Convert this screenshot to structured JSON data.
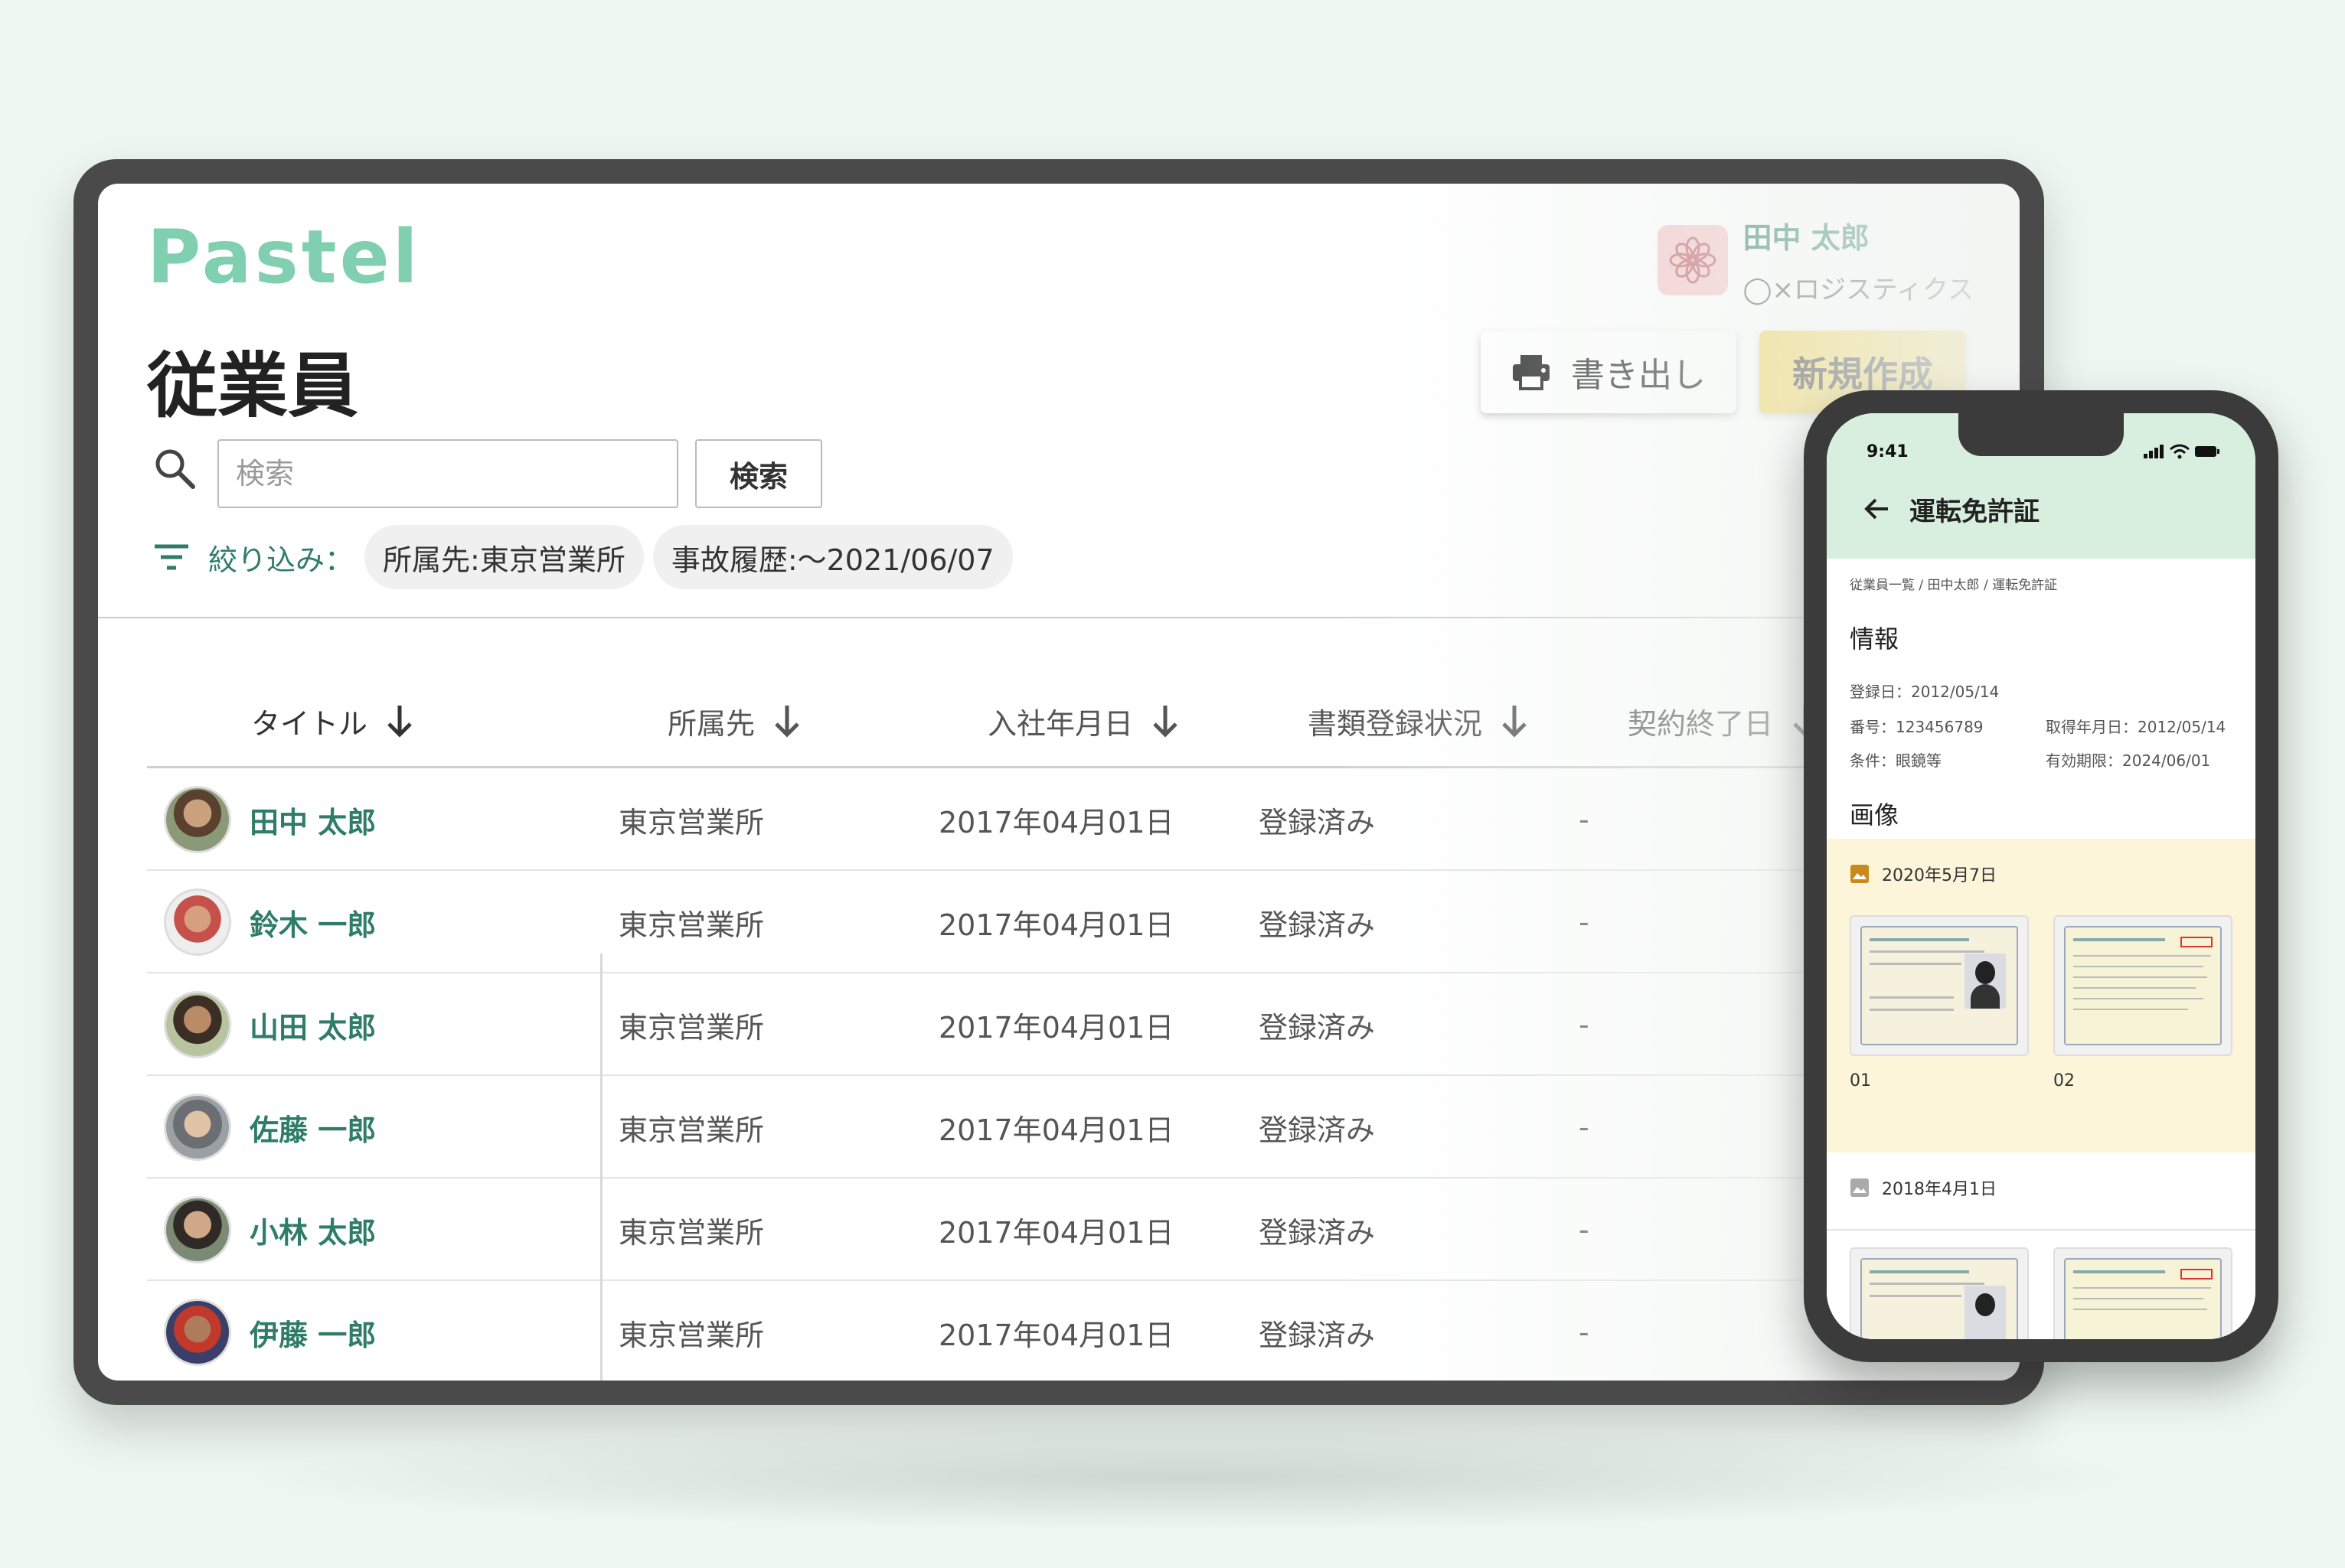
{
  "tablet": {
    "logo": "Pastel",
    "user": {
      "name": "田中 太郎",
      "org": "◯×ロジスティクス"
    },
    "page_title": "従業員",
    "buttons": {
      "export": "書き出し",
      "new": "新規作成"
    },
    "search": {
      "placeholder": "検索",
      "button": "検索"
    },
    "filter": {
      "label": "絞り込み：",
      "chips": [
        "所属先:東京営業所",
        "事故履歴:〜2021/06/07"
      ]
    },
    "table": {
      "columns": [
        "タイトル",
        "所属先",
        "入社年月日",
        "書類登録状況",
        "契約終了日"
      ],
      "rows": [
        {
          "name": "田中 太郎",
          "office": "東京営業所",
          "joined": "2017年04月01日",
          "status": "登録済み",
          "end": "-"
        },
        {
          "name": "鈴木 一郎",
          "office": "東京営業所",
          "joined": "2017年04月01日",
          "status": "登録済み",
          "end": "-"
        },
        {
          "name": "山田 太郎",
          "office": "東京営業所",
          "joined": "2017年04月01日",
          "status": "登録済み",
          "end": "-"
        },
        {
          "name": "佐藤 一郎",
          "office": "東京営業所",
          "joined": "2017年04月01日",
          "status": "登録済み",
          "end": "-"
        },
        {
          "name": "小林 太郎",
          "office": "東京営業所",
          "joined": "2017年04月01日",
          "status": "登録済み",
          "end": "-"
        },
        {
          "name": "伊藤 一郎",
          "office": "東京営業所",
          "joined": "2017年04月01日",
          "status": "登録済み",
          "end": "-"
        }
      ]
    }
  },
  "phone": {
    "time": "9:41",
    "title": "運転免許証",
    "breadcrumb": "従業員一覧 / 田中太郎 / 運転免許証",
    "info": {
      "heading": "情報",
      "registered": "登録日：2012/05/14",
      "number": "番号：123456789",
      "acquired": "取得年月日：2012/05/14",
      "condition": "条件：眼鏡等",
      "expiry": "有効期限：2024/06/01"
    },
    "images": {
      "heading": "画像",
      "group1_date": "2020年5月7日",
      "group1_labels": [
        "01",
        "02"
      ],
      "group2_date": "2018年4月1日"
    }
  },
  "colors": {
    "brand": "#7fcfb0",
    "accent": "#f2d35c",
    "name_link": "#2f7d67",
    "phone_header": "#d8efe0",
    "gallery_bg": "#fcf5d9"
  }
}
